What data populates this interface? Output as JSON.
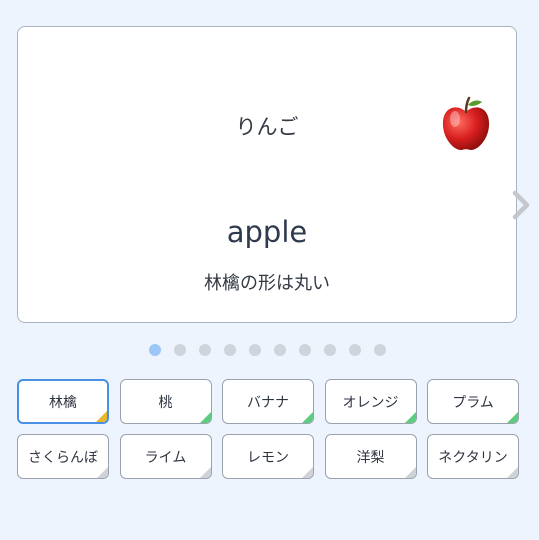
{
  "card": {
    "kana": "りんご",
    "word": "apple",
    "sentence": "林檎の形は丸い",
    "image_icon": "apple-icon",
    "next_icon": "chevron-right-icon"
  },
  "pager": {
    "total": 10,
    "active_index": 0
  },
  "tiles": [
    {
      "label": "林檎",
      "selected": true,
      "marker": "yellow"
    },
    {
      "label": "桃",
      "selected": false,
      "marker": "green"
    },
    {
      "label": "バナナ",
      "selected": false,
      "marker": "green"
    },
    {
      "label": "オレンジ",
      "selected": false,
      "marker": "green"
    },
    {
      "label": "プラム",
      "selected": false,
      "marker": "green"
    },
    {
      "label": "さくらんぼ",
      "selected": false,
      "marker": "gray"
    },
    {
      "label": "ライム",
      "selected": false,
      "marker": "gray"
    },
    {
      "label": "レモン",
      "selected": false,
      "marker": "gray"
    },
    {
      "label": "洋梨",
      "selected": false,
      "marker": "gray"
    },
    {
      "label": "ネクタリン",
      "selected": false,
      "marker": "gray"
    }
  ],
  "colors": {
    "background": "#eef4fd",
    "selected_border": "#4a90e2",
    "active_dot": "#9cc6f6",
    "dot": "#cfd4dc",
    "marker_green": "#5ccc7e",
    "marker_yellow": "#e8b82a",
    "marker_gray": "#cfd2d6"
  }
}
